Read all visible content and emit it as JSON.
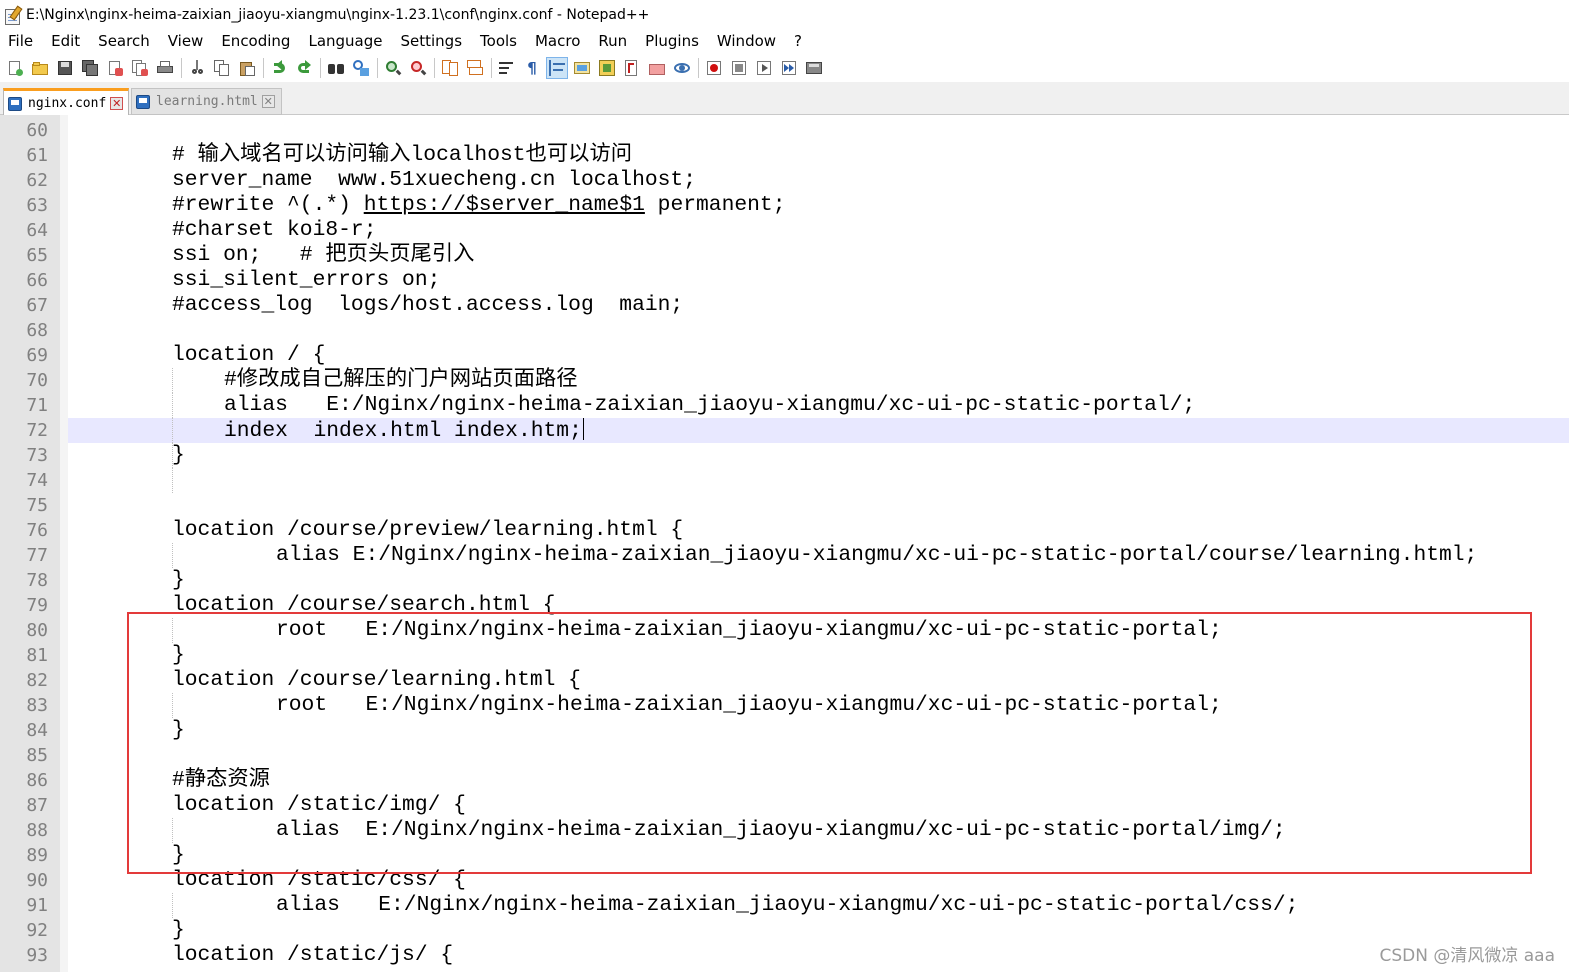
{
  "window": {
    "title": "E:\\Nginx\\nginx-heima-zaixian_jiaoyu-xiangmu\\nginx-1.23.1\\conf\\nginx.conf - Notepad++"
  },
  "menu": [
    "File",
    "Edit",
    "Search",
    "View",
    "Encoding",
    "Language",
    "Settings",
    "Tools",
    "Macro",
    "Run",
    "Plugins",
    "Window",
    "?"
  ],
  "toolbar_icons": [
    "new-file-icon",
    "open-file-icon",
    "save-icon",
    "save-all-icon",
    "close-icon",
    "close-all-icon",
    "print-icon",
    "cut-icon",
    "copy-icon",
    "paste-icon",
    "undo-icon",
    "redo-icon",
    "find-icon",
    "replace-icon",
    "zoom-in-icon",
    "zoom-out-icon",
    "sync-vertical-icon",
    "sync-horizontal-icon",
    "word-wrap-icon",
    "show-all-characters-icon",
    "indent-guide-icon",
    "user-language-icon",
    "doc-map-icon",
    "function-list-icon",
    "folder-as-workspace-icon",
    "monitoring-icon",
    "record-macro-icon",
    "stop-record-icon",
    "playback-macro-icon",
    "run-macro-multiple-icon",
    "save-macro-icon"
  ],
  "tabs": [
    {
      "label": "nginx.conf",
      "active": true
    },
    {
      "label": "learning.html",
      "active": false
    }
  ],
  "editor": {
    "caret_line": 72,
    "lines": [
      {
        "n": "60",
        "text": ""
      },
      {
        "n": "61",
        "text": "# 输入域名可以访问输入localhost也可以访问"
      },
      {
        "n": "62",
        "text": "server_name  www.51xuecheng.cn localhost;"
      },
      {
        "n": "63",
        "text": "#rewrite ^(.*) ",
        "url": "https://$server_name$1",
        "after": " permanent;"
      },
      {
        "n": "64",
        "text": "#charset koi8-r;"
      },
      {
        "n": "65",
        "text": "ssi on;   # 把页头页尾引入"
      },
      {
        "n": "66",
        "text": "ssi_silent_errors on;"
      },
      {
        "n": "67",
        "text": "#access_log  logs/host.access.log  main;"
      },
      {
        "n": "68",
        "text": ""
      },
      {
        "n": "69",
        "text": "location / {"
      },
      {
        "n": "70",
        "text": "#修改成自己解压的门户网站页面路径"
      },
      {
        "n": "71",
        "text": "alias   E:/Nginx/nginx-heima-zaixian_jiaoyu-xiangmu/xc-ui-pc-static-portal/;"
      },
      {
        "n": "72",
        "text": "index  index.html index.htm;"
      },
      {
        "n": "73",
        "text": "}"
      },
      {
        "n": "74",
        "text": ""
      },
      {
        "n": "75",
        "text": ""
      },
      {
        "n": "76",
        "text": "location /course/preview/learning.html {"
      },
      {
        "n": "77",
        "text": "alias E:/Nginx/nginx-heima-zaixian_jiaoyu-xiangmu/xc-ui-pc-static-portal/course/learning.html;"
      },
      {
        "n": "78",
        "text": "}"
      },
      {
        "n": "79",
        "text": "location /course/search.html {"
      },
      {
        "n": "80",
        "text": "root   E:/Nginx/nginx-heima-zaixian_jiaoyu-xiangmu/xc-ui-pc-static-portal;"
      },
      {
        "n": "81",
        "text": "}"
      },
      {
        "n": "82",
        "text": "location /course/learning.html {"
      },
      {
        "n": "83",
        "text": "root   E:/Nginx/nginx-heima-zaixian_jiaoyu-xiangmu/xc-ui-pc-static-portal;"
      },
      {
        "n": "84",
        "text": "}"
      },
      {
        "n": "85",
        "text": ""
      },
      {
        "n": "86",
        "text": "#静态资源"
      },
      {
        "n": "87",
        "text": "location /static/img/ {"
      },
      {
        "n": "88",
        "text": "alias  E:/Nginx/nginx-heima-zaixian_jiaoyu-xiangmu/xc-ui-pc-static-portal/img/;"
      },
      {
        "n": "89",
        "text": "}"
      },
      {
        "n": "90",
        "text": "location /static/css/ {"
      },
      {
        "n": "91",
        "text": "alias   E:/Nginx/nginx-heima-zaixian_jiaoyu-xiangmu/xc-ui-pc-static-portal/css/;"
      },
      {
        "n": "92",
        "text": "}"
      },
      {
        "n": "93",
        "text": "location /static/js/ {"
      }
    ]
  },
  "watermark": "CSDN @清风微凉 aaa",
  "colors": {
    "highlight_box": "#e33a3a",
    "tab_accent": "#fa9e1f",
    "caret_line_bg": "#e8e8ff"
  }
}
